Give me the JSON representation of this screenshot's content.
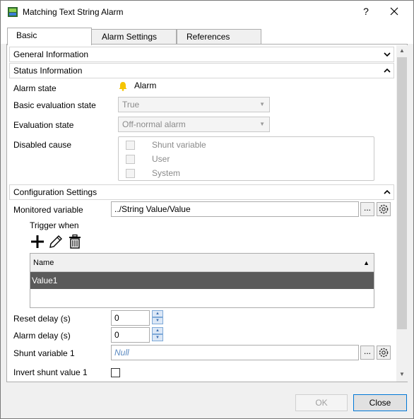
{
  "window": {
    "title": "Matching Text String Alarm",
    "help_label": "?",
    "close_label": "✕"
  },
  "tabs": [
    {
      "label": "Basic",
      "active": true
    },
    {
      "label": "Alarm Settings",
      "active": false
    },
    {
      "label": "References",
      "active": false
    }
  ],
  "sections": {
    "general": {
      "title": "General Information",
      "expanded": false
    },
    "status": {
      "title": "Status Information",
      "expanded": true
    },
    "config": {
      "title": "Configuration Settings",
      "expanded": true
    }
  },
  "status": {
    "alarm_state_label": "Alarm state",
    "alarm_state_value": "Alarm",
    "alarm_icon_color": "#f5c400",
    "basic_eval_label": "Basic evaluation state",
    "basic_eval_value": "True",
    "eval_state_label": "Evaluation state",
    "eval_state_value": "Off-normal alarm",
    "disabled_cause_label": "Disabled cause",
    "disabled_causes": [
      "Shunt variable",
      "User",
      "System"
    ]
  },
  "config": {
    "monitored_variable_label": "Monitored variable",
    "monitored_variable_value": "../String Value/Value",
    "browse_label": "...",
    "trigger_when_label": "Trigger when",
    "grid_header": "Name",
    "grid_rows": [
      "Value1"
    ],
    "reset_delay_label": "Reset delay (s)",
    "reset_delay_value": "0",
    "alarm_delay_label": "Alarm delay (s)",
    "alarm_delay_value": "0",
    "shunt_variable_label": "Shunt variable 1",
    "shunt_variable_placeholder": "Null",
    "invert_shunt_label": "Invert shunt value 1"
  },
  "footer": {
    "ok_label": "OK",
    "close_label": "Close"
  }
}
